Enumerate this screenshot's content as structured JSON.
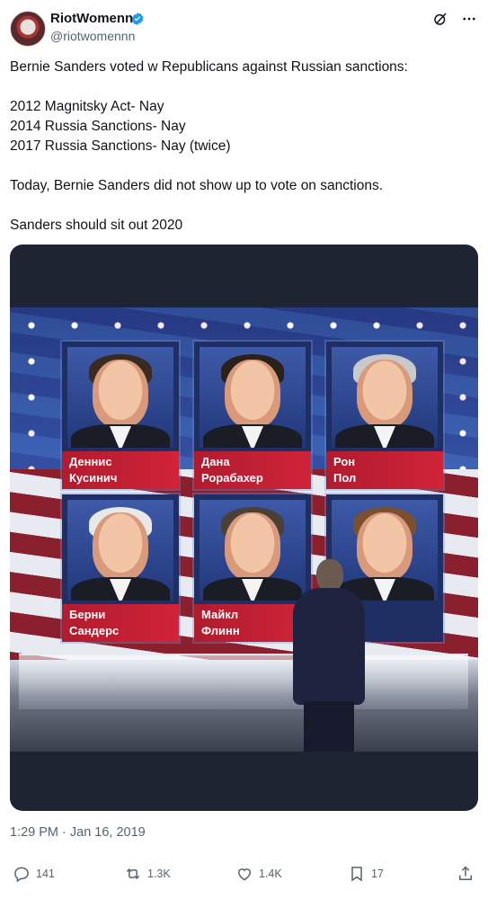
{
  "author": {
    "display_name": "RiotWomenn",
    "handle": "@riotwomennn"
  },
  "tweet": {
    "text": "Bernie Sanders voted w Republicans against Russian sanctions:\n\n2012 Magnitsky Act- Nay\n2014 Russia Sanctions- Nay\n2017 Russia Sanctions- Nay (twice)\n\nToday, Bernie Sanders did not show up to vote on sanctions.\n\nSanders should sit out 2020",
    "timestamp": "1:29 PM · Jan 16, 2019"
  },
  "image": {
    "cards": [
      {
        "line1": "Деннис",
        "line2": "Кусинич",
        "hair": "#3a2a22"
      },
      {
        "line1": "Дана",
        "line2": "Рорабахер",
        "hair": "#2a211c"
      },
      {
        "line1": "Рон",
        "line2": "Пол",
        "hair": "#c9c9c9"
      },
      {
        "line1": "Берни",
        "line2": "Сандерс",
        "hair": "#e8e8e8"
      },
      {
        "line1": "Майкл",
        "line2": "Флинн",
        "hair": "#4a4038"
      },
      {
        "line1": "",
        "line2": "",
        "hair": "#7a5030"
      }
    ]
  },
  "actions": {
    "replies": "141",
    "reposts": "1.3K",
    "likes": "1.4K",
    "bookmarks": "17"
  },
  "icons": {
    "verified": "verified-badge-icon",
    "grok": "grok-icon",
    "more": "more-icon",
    "reply": "reply-icon",
    "repost": "repost-icon",
    "like": "like-icon",
    "bookmark": "bookmark-icon",
    "share": "share-icon"
  },
  "colors": {
    "verified": "#1d9bf0",
    "muted": "#536471",
    "card_label": "#c8203a"
  }
}
